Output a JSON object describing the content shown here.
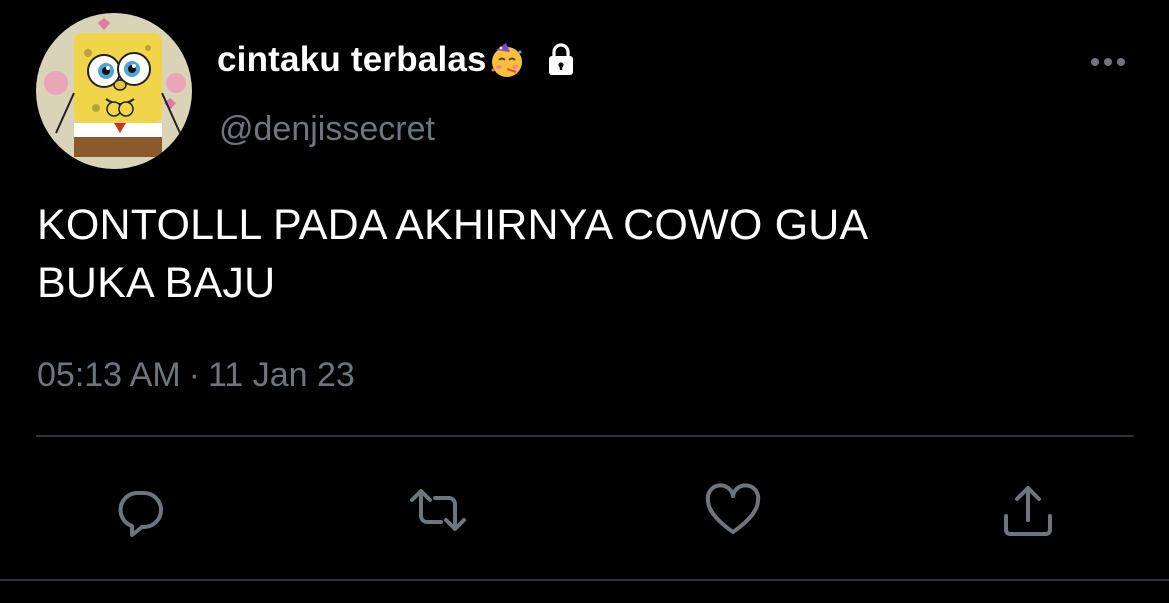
{
  "author": {
    "display_name": "cintaku terbalas",
    "emoji_icon": "partying-face-emoji",
    "protected_icon": "lock-icon",
    "handle": "@denjissecret",
    "avatar": "spongebob-avatar"
  },
  "tweet": {
    "text_line1": "KONTOLLL PADA AKHIRNYA COWO GUA",
    "text_line2": "BUKA BAJU",
    "time": "05:13 AM",
    "separator": "·",
    "date": "11 Jan 23"
  },
  "actions": {
    "reply_icon": "reply-icon",
    "retweet_icon": "retweet-icon",
    "like_icon": "heart-icon",
    "share_icon": "share-icon",
    "more_icon": "more-icon"
  },
  "colors": {
    "background": "#000000",
    "text": "#ffffff",
    "secondary": "#6e767d",
    "divider": "#2f3336"
  }
}
